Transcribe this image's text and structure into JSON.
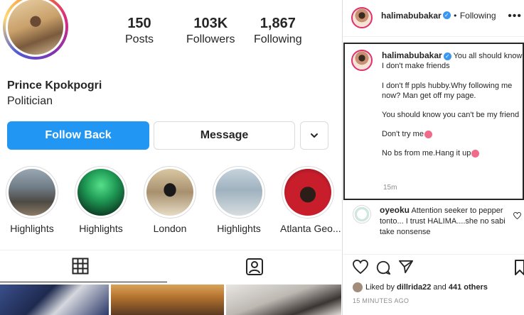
{
  "profile": {
    "name": "Prince Kpokpogri",
    "bio": "Politician",
    "stats": [
      {
        "value": "150",
        "label": "Posts"
      },
      {
        "value": "103K",
        "label": "Followers"
      },
      {
        "value": "1,867",
        "label": "Following"
      }
    ],
    "buttons": {
      "follow_back": "Follow Back",
      "message": "Message"
    },
    "highlights": [
      {
        "label": "Highlights"
      },
      {
        "label": "Highlights"
      },
      {
        "label": "London"
      },
      {
        "label": "Highlights"
      },
      {
        "label": "Atlanta Geo..."
      }
    ]
  },
  "post": {
    "header": {
      "username": "halimabubakar",
      "separator": "•",
      "following": "Following"
    },
    "caption": {
      "username": "halimabubakar",
      "line1": "You all should know I don't make friends",
      "para2": "I don't ff ppls hubby.Why following me now? Man get off my page.",
      "para3": "You should know you can't be my friend",
      "para4": "Don't try me",
      "para5": "No bs from me.Hang it up",
      "time": "15m"
    },
    "comment": {
      "username": "oyeoku",
      "text": "Attention seeker to pepper tonto... I trust HALIMA....she no sabi take nonsense"
    },
    "likes": {
      "prefix": "Liked by",
      "user": "dillrida22",
      "middle": "and",
      "others": "441 others"
    },
    "time_ago": "15 MINUTES AGO"
  },
  "colors": {
    "follow_blue": "#2196f3",
    "verified_blue": "#3897f0",
    "text_dark": "#262626",
    "muted": "#8e8e8e"
  }
}
